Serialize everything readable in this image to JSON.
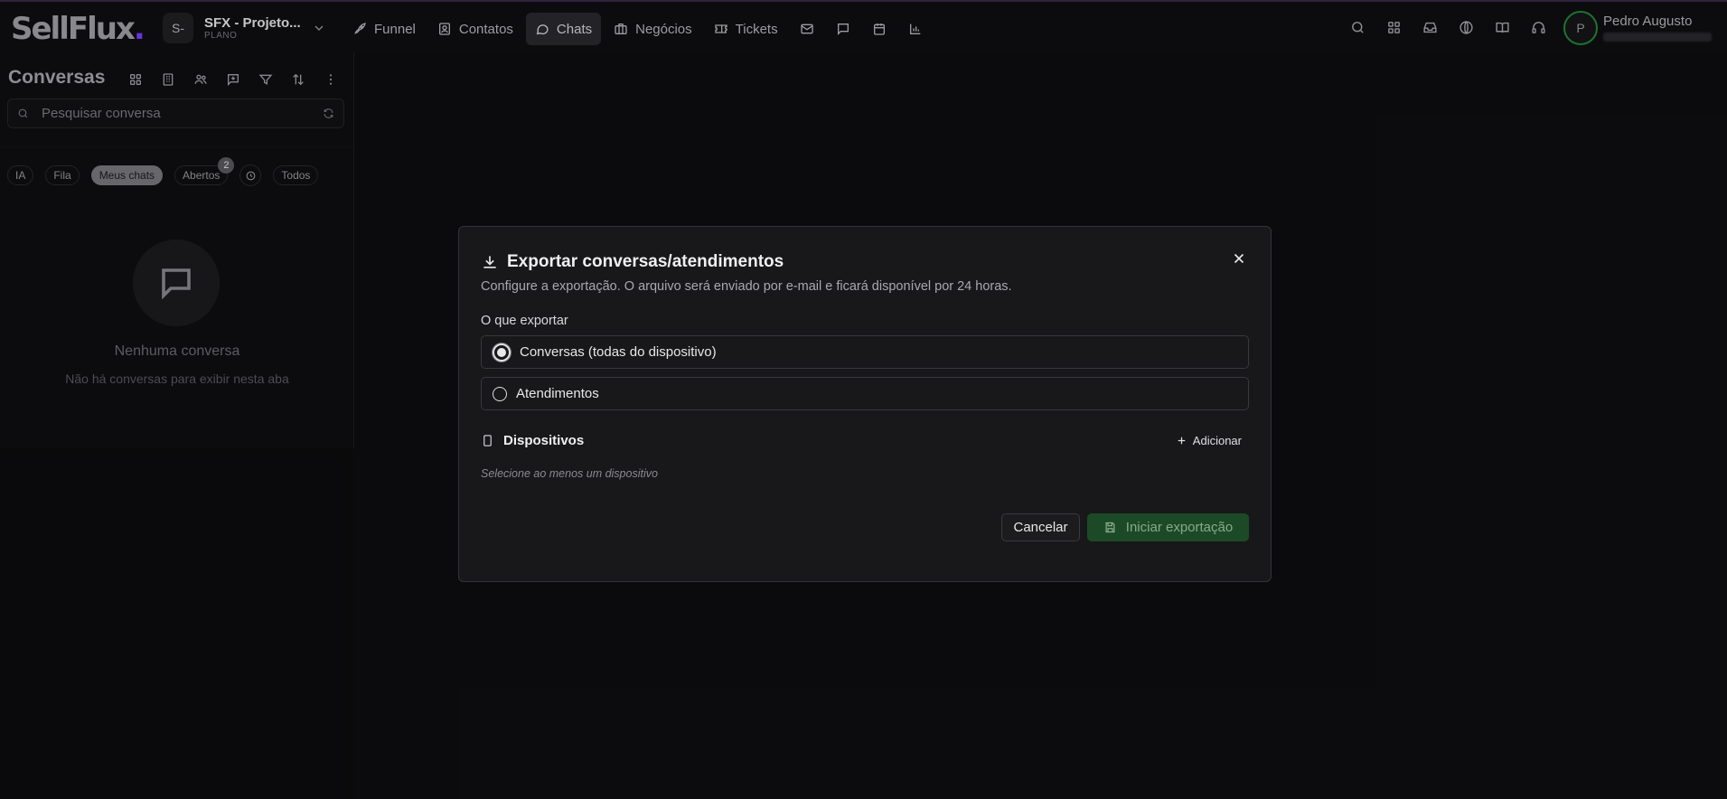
{
  "app": {
    "logo_text": "SellFlux",
    "logo_dot": ".",
    "project_badge": "S-",
    "project_name": "SFX - Projeto...",
    "project_plan": "PLANO",
    "accent_color": "#7a3cff",
    "success_color": "#1f8a3a"
  },
  "nav": {
    "items": [
      {
        "label": "Funnel",
        "icon": "rocket-icon"
      },
      {
        "label": "Contatos",
        "icon": "contact-icon"
      },
      {
        "label": "Chats",
        "icon": "chat-icon",
        "active": true
      },
      {
        "label": "Negócios",
        "icon": "briefcase-icon"
      },
      {
        "label": "Tickets",
        "icon": "ticket-icon"
      }
    ],
    "extra_icons": [
      "mail-icon",
      "message-square-icon",
      "calendar-icon",
      "bar-chart-icon"
    ]
  },
  "header_right": {
    "icons": [
      "search-icon",
      "apps-grid-icon",
      "inbox-icon",
      "globe-icon",
      "book-icon",
      "headset-icon"
    ],
    "user": {
      "initial": "P",
      "name": "Pedro Augusto"
    }
  },
  "sidebar": {
    "title": "Conversas",
    "tool_icons": [
      "grid-icon",
      "building-icon",
      "users-icon",
      "message-plus-icon",
      "filter-icon",
      "sort-icon",
      "more-vertical-icon"
    ],
    "search": {
      "placeholder": "Pesquisar conversa",
      "value": ""
    },
    "filters": [
      {
        "label": "IA"
      },
      {
        "label": "Fila"
      },
      {
        "label": "Meus chats",
        "active": true
      },
      {
        "label": "Abertos",
        "count": "2"
      },
      {
        "label": "",
        "icon": "clock-icon"
      },
      {
        "label": "Todos"
      }
    ],
    "empty": {
      "title": "Nenhuma conversa",
      "subtitle": "Não há conversas para exibir nesta aba"
    }
  },
  "modal": {
    "title": "Exportar conversas/atendimentos",
    "description": "Configure a exportação. O arquivo será enviado por e-mail e ficará disponível por 24 horas.",
    "section_label": "O que exportar",
    "options": [
      {
        "label": "Conversas (todas do dispositivo)",
        "selected": true
      },
      {
        "label": "Atendimentos",
        "selected": false
      }
    ],
    "devices_title": "Dispositivos",
    "add_label": "Adicionar",
    "devices_hint": "Selecione ao menos um dispositivo",
    "cancel_label": "Cancelar",
    "export_label": "Iniciar exportação"
  }
}
